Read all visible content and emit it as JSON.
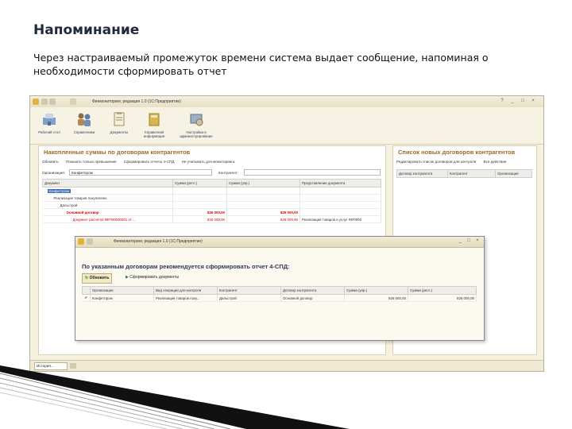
{
  "slide": {
    "title": "Напоминание",
    "text": "Через настраиваемый промежуток времени система выдает сообщение, напоминая о необходимости сформировать отчет"
  },
  "app": {
    "window_title": "Финмониторинг, редакция 1.0  (1С:Предприятие)",
    "sections": [
      "Рабочий стол",
      "Справочники",
      "Документы",
      "Справочная информация",
      "Настройка и администрирование"
    ],
    "left_panel": {
      "title": "Накопленные суммы по договорам контрагентов",
      "toolbar": [
        "Обновить",
        "Показать только превышения",
        "Сформировать отчеты 4-СПД",
        "Не учитывать для мониторинга"
      ],
      "org_label": "Организация:",
      "org_value": "Конфетпром",
      "counterparty_label": "Контрагент:",
      "columns": [
        "Документ",
        "Сумма (регл.)",
        "Сумма (упр.)",
        "Представление документа"
      ],
      "rows": [
        {
          "doc": "Конфетпром",
          "sum_reg": "",
          "sum_upr": "",
          "repr": ""
        },
        {
          "doc": "Реализация товаров покупателю",
          "sum_reg": "",
          "sum_upr": "",
          "repr": ""
        },
        {
          "doc": "Дальстрой",
          "sum_reg": "",
          "sum_upr": "",
          "repr": ""
        },
        {
          "doc": "Основной договор",
          "sum_reg": "826 000,00",
          "sum_upr": "826 000,00",
          "repr": ""
        },
        {
          "doc": "Документ расчетов КФП00000001 от ...",
          "sum_reg": "826 000,00",
          "sum_upr": "826 000,00",
          "repr": "Реализация товаров и услуг КФП000"
        }
      ]
    },
    "right_panel": {
      "title": "Список новых договоров контрагентов",
      "toolbar": [
        "Редактировать список договоров для контроля",
        "Все действия"
      ],
      "columns": [
        "Договор контрагента",
        "Контрагент",
        "Организация"
      ]
    },
    "dialog": {
      "window_title": "Финмониторинг, редакция 1.0  (1С:Предприятие)",
      "heading": "По указанным договорам рекомендуется сформировать отчет 4-СПД:",
      "refresh_label": "Обновить",
      "generate_label": "Сформировать документы",
      "columns": [
        "Организация",
        "Вид операции для контроля",
        "Контрагент",
        "Договор контрагента",
        "Сумма (упр.)",
        "Сумма (регл.)"
      ],
      "rows": [
        {
          "org": "Конфетпром",
          "op": "Реализация товаров поку...",
          "counterparty": "Дальстрой",
          "contract": "Основной договор",
          "sum_upr": "826 000,00",
          "sum_reg": "826 000,00",
          "checked": true
        }
      ]
    },
    "status": {
      "history_label": "История..."
    },
    "colors": {
      "accent_title": "#9a6a2a",
      "highlight_red": "#d50000",
      "window_bg": "#f6f1de"
    }
  }
}
